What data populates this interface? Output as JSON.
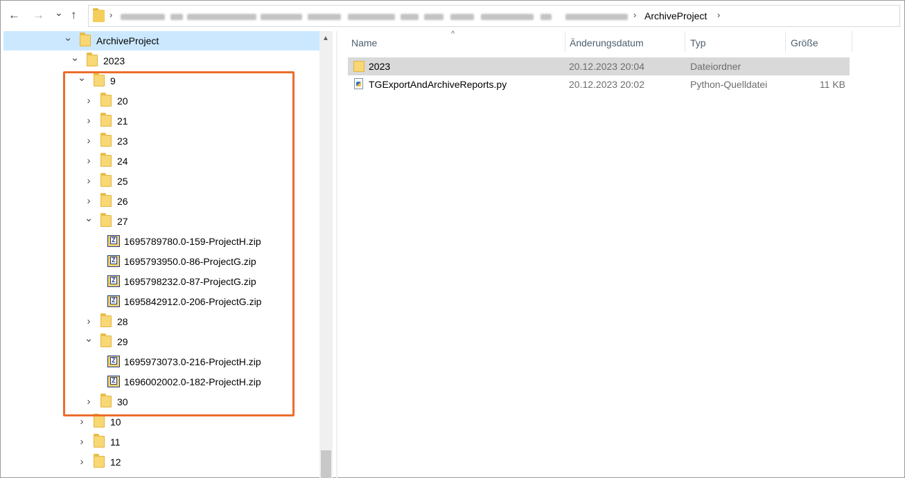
{
  "nav": {
    "back": "←",
    "forward": "→",
    "recent": "⌄",
    "up": "↑"
  },
  "address": {
    "separator": "›",
    "current": "ArchiveProject",
    "after": "›"
  },
  "tree": {
    "items": [
      {
        "label": "ArchiveProject",
        "level": 1,
        "chevron": "⌄",
        "kind": "folder",
        "selected": true
      },
      {
        "label": "2023",
        "level": 2,
        "chevron": "⌄",
        "kind": "folder"
      },
      {
        "label": "9",
        "level": 3,
        "chevron": "⌄",
        "kind": "folder"
      },
      {
        "label": "20",
        "level": 4,
        "chevron": "›",
        "kind": "folder"
      },
      {
        "label": "21",
        "level": 4,
        "chevron": "›",
        "kind": "folder"
      },
      {
        "label": "23",
        "level": 4,
        "chevron": "›",
        "kind": "folder"
      },
      {
        "label": "24",
        "level": 4,
        "chevron": "›",
        "kind": "folder"
      },
      {
        "label": "25",
        "level": 4,
        "chevron": "›",
        "kind": "folder"
      },
      {
        "label": "26",
        "level": 4,
        "chevron": "›",
        "kind": "folder"
      },
      {
        "label": "27",
        "level": 4,
        "chevron": "⌄",
        "kind": "folder"
      },
      {
        "label": "1695789780.0-159-ProjectH.zip",
        "level": 5,
        "chevron": "",
        "kind": "zip"
      },
      {
        "label": "1695793950.0-86-ProjectG.zip",
        "level": 5,
        "chevron": "",
        "kind": "zip"
      },
      {
        "label": "1695798232.0-87-ProjectG.zip",
        "level": 5,
        "chevron": "",
        "kind": "zip"
      },
      {
        "label": "1695842912.0-206-ProjectG.zip",
        "level": 5,
        "chevron": "",
        "kind": "zip"
      },
      {
        "label": "28",
        "level": 4,
        "chevron": "›",
        "kind": "folder"
      },
      {
        "label": "29",
        "level": 4,
        "chevron": "⌄",
        "kind": "folder"
      },
      {
        "label": "1695973073.0-216-ProjectH.zip",
        "level": 5,
        "chevron": "",
        "kind": "zip"
      },
      {
        "label": "1696002002.0-182-ProjectH.zip",
        "level": 5,
        "chevron": "",
        "kind": "zip"
      },
      {
        "label": "30",
        "level": 4,
        "chevron": "›",
        "kind": "folder"
      },
      {
        "label": "10",
        "level": 3,
        "chevron": "›",
        "kind": "folder"
      },
      {
        "label": "11",
        "level": 3,
        "chevron": "›",
        "kind": "folder"
      },
      {
        "label": "12",
        "level": 3,
        "chevron": "›",
        "kind": "folder"
      }
    ],
    "zip_glyph": "Z",
    "scroll_up": "▲"
  },
  "list": {
    "sort_indicator": "^",
    "columns": {
      "name": "Name",
      "modified": "Änderungsdatum",
      "type": "Typ",
      "size": "Größe"
    },
    "files": [
      {
        "name": "2023",
        "modified": "20.12.2023 20:04",
        "type": "Dateiordner",
        "size": "",
        "kind": "folder",
        "selected": true
      },
      {
        "name": "TGExportAndArchiveReports.py",
        "modified": "20.12.2023 20:02",
        "type": "Python-Quelldatei",
        "size": "11 KB",
        "kind": "py",
        "selected": false
      }
    ]
  },
  "colors": {
    "highlight_border": "#ec6d2b",
    "tree_selection": "#cce8ff",
    "list_selection": "#d9d9d9",
    "folder": "#f8d775"
  }
}
